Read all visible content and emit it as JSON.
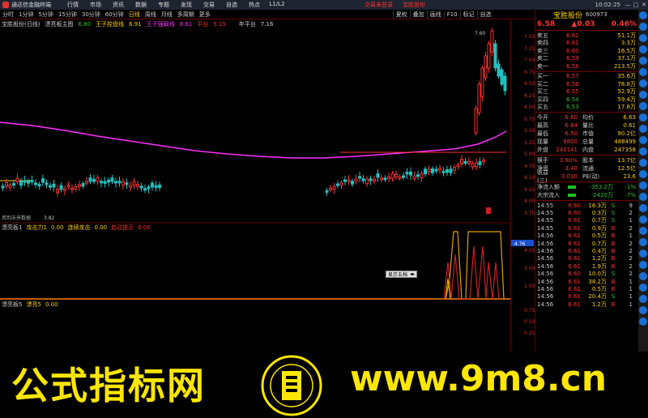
{
  "titlebar": {
    "app": "通达信金融终端",
    "menu": [
      "行情",
      "市场",
      "资讯",
      "数据",
      "专题",
      "发现",
      "交易",
      "自选",
      "热点",
      "L1/L2"
    ],
    "alert": "交易未登录",
    "stock": "宝胜股份",
    "time": "10:02:25",
    "win": [
      "—",
      "□",
      "✕"
    ]
  },
  "toolbar": {
    "periods": [
      "分时",
      "1分钟",
      "5分钟",
      "15分钟",
      "30分钟",
      "60分钟",
      "日线",
      "周线",
      "月线",
      "多周期",
      "更多"
    ],
    "selected": "日线",
    "right": [
      "夏权",
      "叠加",
      "画线",
      "F10",
      "标记",
      "自选"
    ]
  },
  "chart_info": {
    "name": "宝胜股份(日线)",
    "indicator": "漂亮板主图",
    "v1": "6.80",
    "l2": "王子控盘线",
    "v2": "6.91",
    "l3": "王子强弱线",
    "v3": "8.61",
    "l4": "平台",
    "v4": "5.15",
    "l5": "年平台",
    "v5": "7.16",
    "peak": "7.60",
    "hint": "用到未来数据",
    "low": "3.82"
  },
  "sub1": {
    "name": "漂亮板1",
    "a": "攻击力1",
    "av": "0.00",
    "b": "连续攻击",
    "bv": "0.00",
    "c": "启动提示",
    "cv": "0.00",
    "cur": "4.76"
  },
  "sub2": {
    "name": "漂亮板5",
    "a": "漂亮5",
    "av": "0.00"
  },
  "axis_main": [
    "7.50",
    "7.25",
    "7.00",
    "6.75",
    "6.50",
    "6.25",
    "6.00",
    "5.75",
    "5.50",
    "5.25",
    "5.00",
    "4.75",
    "4.50",
    "4.25",
    "4.00",
    "3.75"
  ],
  "axis_sub1": [
    "4.50",
    "3.00",
    "1.50"
  ],
  "axis_sub2": [
    "0.75",
    "0.50",
    "0.25"
  ],
  "popup": "显示五档",
  "panel": {
    "name": "宝胜股份",
    "code": "600973",
    "price": "6.58",
    "change": "▲0.03",
    "pct": "0.46%",
    "asks": [
      {
        "l": "卖五",
        "p": "6.62",
        "v": "51.1万"
      },
      {
        "l": "卖四",
        "p": "6.61",
        "v": "3.3万"
      },
      {
        "l": "卖三",
        "p": "6.60",
        "v": "16.5万"
      },
      {
        "l": "卖二",
        "p": "6.59",
        "v": "37.1万"
      },
      {
        "l": "卖一",
        "p": "6.58",
        "v": "213.5万"
      }
    ],
    "bids": [
      {
        "l": "买一",
        "p": "6.57",
        "v": "35.6万"
      },
      {
        "l": "买二",
        "p": "6.56",
        "v": "78.8万"
      },
      {
        "l": "买三",
        "p": "6.55",
        "v": "52.9万"
      },
      {
        "l": "买四",
        "p": "6.54",
        "v": "59.4万"
      },
      {
        "l": "买五",
        "p": "6.53",
        "v": "17.8万"
      }
    ],
    "stats": [
      {
        "l": "今开",
        "a": "6.60",
        "l2": "均价",
        "b": "6.63"
      },
      {
        "l": "最高",
        "a": "6.84",
        "l2": "量比",
        "b": "0.61"
      },
      {
        "l": "最低",
        "a": "6.50",
        "l2": "市值",
        "b": "90.2亿"
      },
      {
        "l": "现量",
        "a": "9800",
        "l2": "总量",
        "b": "488499"
      },
      {
        "l": "外盘",
        "a": "241141",
        "l2": "内盘",
        "b": "247358"
      }
    ],
    "stats2": [
      {
        "l": "换手",
        "a": "3.90%",
        "l2": "股本",
        "b": "13.7亿"
      },
      {
        "l": "净资",
        "a": "3.40",
        "l2": "流通",
        "b": "12.5亿"
      },
      {
        "l": "收益(三)",
        "a": "0.010",
        "l2": "PE(动)",
        "b": "23.6"
      }
    ],
    "flows": [
      {
        "l": "净流入额",
        "v": "-353.2万",
        "pc": "-1%"
      },
      {
        "l": "大宗流入",
        "v": "-2420万",
        "pc": "-7%"
      }
    ],
    "ticks": [
      {
        "t": "14:55",
        "p": "6.60",
        "v": "16.3万",
        "d": "S",
        "n": "9"
      },
      {
        "t": "14:55",
        "p": "6.60",
        "v": "0.3万",
        "d": "S",
        "n": "2"
      },
      {
        "t": "14:55",
        "p": "6.61",
        "v": "0.7万",
        "d": "S",
        "n": "1"
      },
      {
        "t": "14:55",
        "p": "6.61",
        "v": "0.9万",
        "d": "B",
        "n": "2"
      },
      {
        "t": "14:56",
        "p": "6.61",
        "v": "0.5万",
        "d": "B",
        "n": "1"
      },
      {
        "t": "14:56",
        "p": "6.61",
        "v": "0.7万",
        "d": "B",
        "n": "2"
      },
      {
        "t": "14:56",
        "p": "6.61",
        "v": "0.4万",
        "d": "B",
        "n": "2"
      },
      {
        "t": "14:56",
        "p": "6.61",
        "v": "1.2万",
        "d": "B",
        "n": "2"
      },
      {
        "t": "14:56",
        "p": "6.61",
        "v": "1.9万",
        "d": "B",
        "n": "2"
      },
      {
        "t": "14:56",
        "p": "6.60",
        "v": "10.0万",
        "d": "S",
        "n": "2"
      },
      {
        "t": "14:56",
        "p": "6.61",
        "v": "38.2万",
        "d": "B",
        "n": "1"
      },
      {
        "t": "14:56",
        "p": "6.61",
        "v": "0.5万",
        "d": "B",
        "n": "1"
      },
      {
        "t": "14:56",
        "p": "6.61",
        "v": "20.4万",
        "d": "S",
        "n": "1"
      },
      {
        "t": "14:56",
        "p": "6.61",
        "v": "1.2万",
        "d": "B",
        "n": "1"
      }
    ]
  },
  "watermark": {
    "cn": "公式指标网",
    "url": "www.9m8.cn"
  },
  "colors": {
    "up": "#ff3333",
    "down": "#30c030",
    "ma": "#ff40ff",
    "accent": "#ffd000"
  }
}
